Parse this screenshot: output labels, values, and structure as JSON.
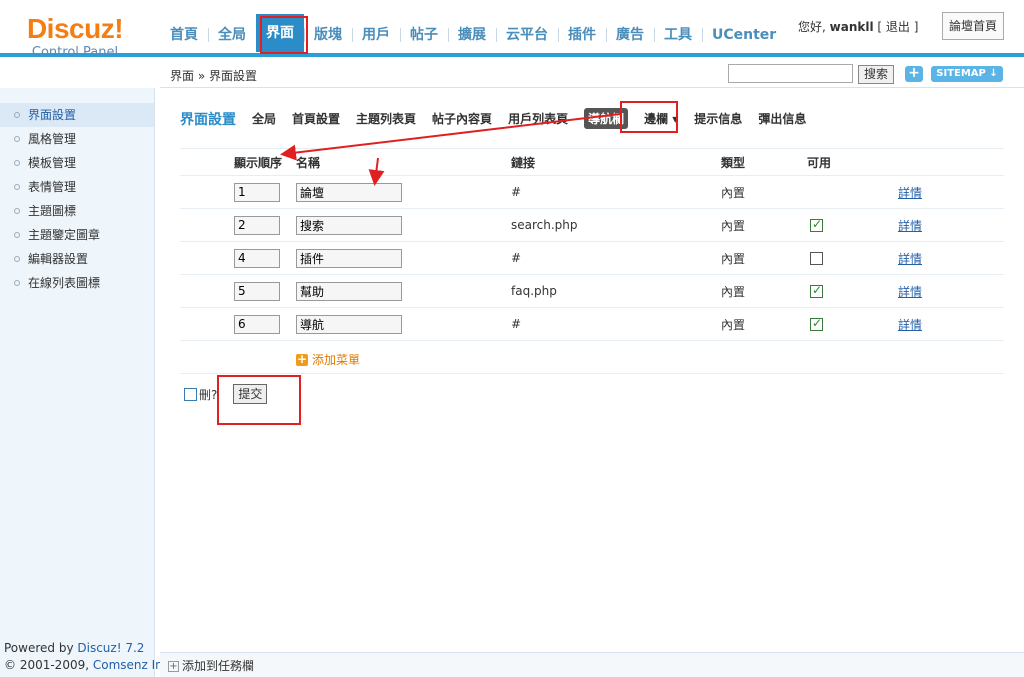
{
  "logo": {
    "name": "Discuz!",
    "sub": "Control Panel"
  },
  "topnav": [
    {
      "label": "首頁",
      "active": false
    },
    {
      "label": "全局",
      "active": false
    },
    {
      "label": "界面",
      "active": true
    },
    {
      "label": "版塊",
      "active": false
    },
    {
      "label": "用戶",
      "active": false
    },
    {
      "label": "帖子",
      "active": false
    },
    {
      "label": "擴展",
      "active": false
    },
    {
      "label": "云平台",
      "active": false
    },
    {
      "label": "插件",
      "active": false
    },
    {
      "label": "廣告",
      "active": false
    },
    {
      "label": "工具",
      "active": false
    },
    {
      "label": "UCenter",
      "active": false
    }
  ],
  "user": {
    "greeting": "您好,",
    "name": "wankll",
    "logout": "[ 退出 ]",
    "forum_home": "論壇首頁"
  },
  "breadcrumb": "界面 » 界面設置",
  "search": {
    "value": "",
    "button": "搜索",
    "plus": "+",
    "sitemap": "SITEMAP ↓"
  },
  "sidebar": {
    "items": [
      {
        "label": "界面設置",
        "active": true
      },
      {
        "label": "風格管理",
        "active": false
      },
      {
        "label": "模板管理",
        "active": false
      },
      {
        "label": "表情管理",
        "active": false
      },
      {
        "label": "主題圖標",
        "active": false
      },
      {
        "label": "主題鑒定圖章",
        "active": false
      },
      {
        "label": "編輯器設置",
        "active": false
      },
      {
        "label": "在線列表圖標",
        "active": false
      }
    ],
    "powered_prefix": "Powered by ",
    "powered_link": "Discuz! 7.2",
    "copyright_prefix": "© 2001-2009, ",
    "copyright_link": "Comsenz Inc."
  },
  "taskbar": {
    "label": "添加到任務欄",
    "icon": "+"
  },
  "page": {
    "title": "界面設置",
    "tabs": [
      {
        "label": "全局",
        "active": false
      },
      {
        "label": "首頁設置",
        "active": false
      },
      {
        "label": "主題列表頁",
        "active": false
      },
      {
        "label": "帖子內容頁",
        "active": false
      },
      {
        "label": "用戶列表頁",
        "active": false
      },
      {
        "label": "導航欄",
        "active": true
      },
      {
        "label": "邊欄 ▾",
        "active": false
      },
      {
        "label": "提示信息",
        "active": false
      },
      {
        "label": "彈出信息",
        "active": false
      }
    ]
  },
  "table": {
    "headers": {
      "order": "顯示順序",
      "name": "名稱",
      "link": "鏈接",
      "type": "類型",
      "enabled": "可用"
    },
    "rows": [
      {
        "order": "1",
        "name": "論壇",
        "link": "#",
        "type": "內置",
        "enabled": null,
        "detail": "詳情"
      },
      {
        "order": "2",
        "name": "搜索",
        "link": "search.php",
        "type": "內置",
        "enabled": true,
        "detail": "詳情"
      },
      {
        "order": "4",
        "name": "插件",
        "link": "#",
        "type": "內置",
        "enabled": false,
        "detail": "詳情"
      },
      {
        "order": "5",
        "name": "幫助",
        "link": "faq.php",
        "type": "內置",
        "enabled": true,
        "detail": "詳情"
      },
      {
        "order": "6",
        "name": "導航",
        "link": "#",
        "type": "內置",
        "enabled": true,
        "detail": "詳情"
      }
    ],
    "add_menu": "添加菜單"
  },
  "footer": {
    "delete_label": "刪?",
    "submit": "提交"
  },
  "colors": {
    "accent": "#2b8cc8",
    "logo": "#f47d14",
    "annotation": "#e02020",
    "link": "#2460a7"
  }
}
